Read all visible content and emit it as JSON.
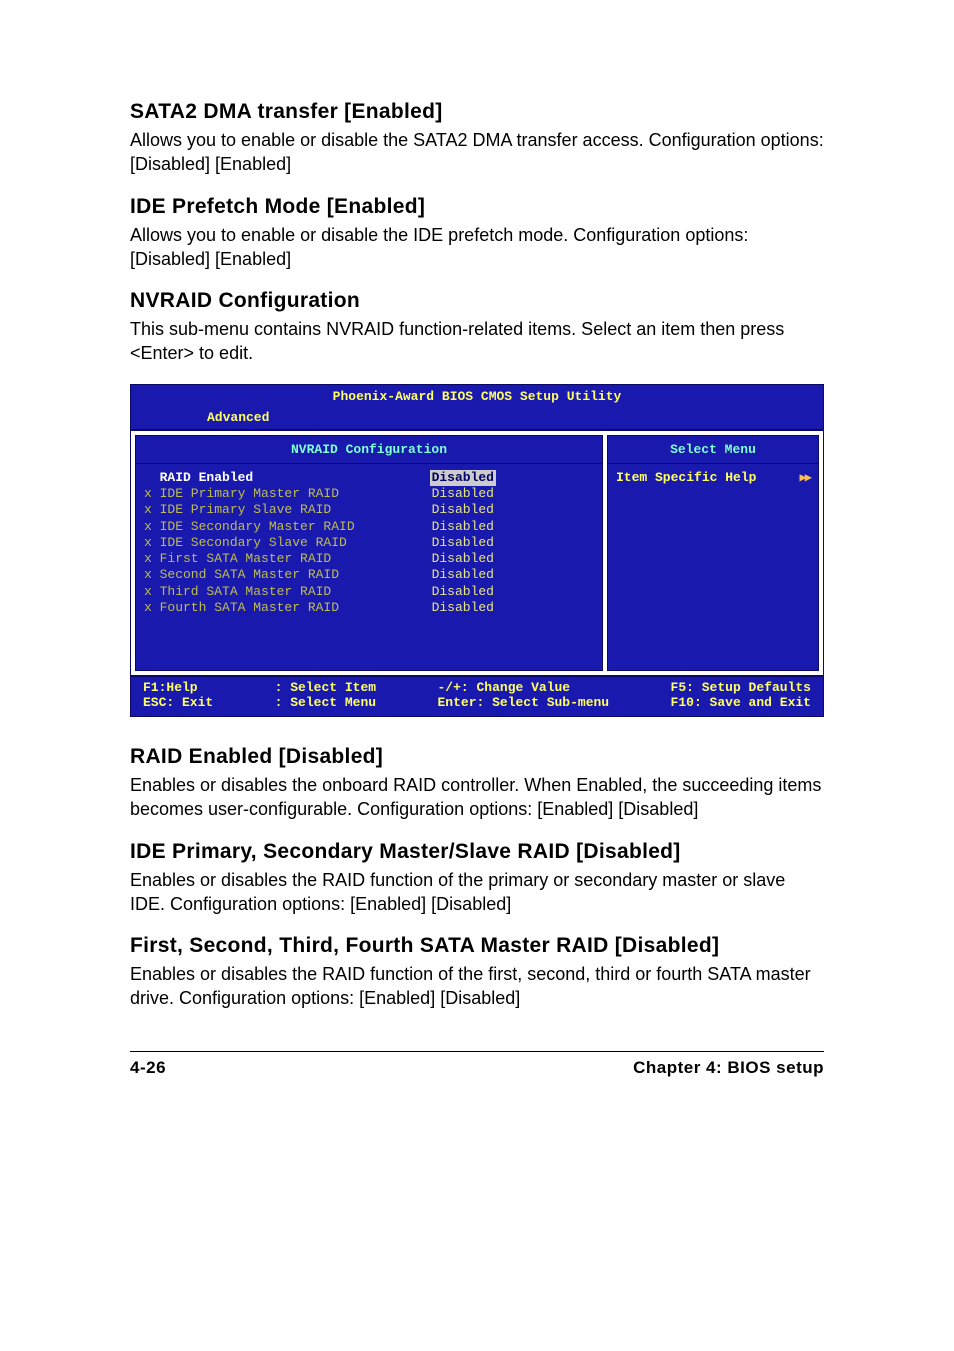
{
  "sections": {
    "sata2": {
      "heading": "SATA2 DMA transfer [Enabled]",
      "body": "Allows you to enable or disable the SATA2 DMA transfer access. Configuration options: [Disabled] [Enabled]"
    },
    "idePrefetch": {
      "heading": "IDE Prefetch Mode [Enabled]",
      "body": "Allows you to enable or disable the IDE prefetch mode. Configuration options: [Disabled] [Enabled]"
    },
    "nvraid": {
      "heading": "NVRAID Configuration",
      "body": "This sub-menu contains NVRAID function-related items. Select an item then press <Enter> to edit."
    },
    "raidEnabled": {
      "heading": "RAID Enabled [Disabled]",
      "body": "Enables or disables the onboard RAID controller. When Enabled, the succeeding items becomes user-configurable. Configuration options: [Enabled] [Disabled]"
    },
    "idePrimSec": {
      "heading": "IDE Primary, Secondary Master/Slave RAID [Disabled]",
      "body": "Enables or disables the RAID function of the primary or secondary master or slave IDE. Configuration options: [Enabled] [Disabled]"
    },
    "sataMaster": {
      "heading": "First, Second, Third, Fourth SATA Master RAID [Disabled]",
      "body": "Enables or disables the RAID function of the first, second, third or fourth SATA master drive. Configuration options: [Enabled] [Disabled]"
    }
  },
  "bios": {
    "title": "Phoenix-Award BIOS CMOS Setup Utility",
    "tab": "Advanced",
    "leftTitle": "NVRAID Configuration",
    "rightTitle": "Select Menu",
    "help": "Item Specific Help",
    "items": [
      {
        "label": "  RAID Enabled",
        "value": "Disabled",
        "selected": true,
        "dim": false
      },
      {
        "label": "x IDE Primary Master RAID",
        "value": "Disabled",
        "selected": false,
        "dim": true
      },
      {
        "label": "x IDE Primary Slave RAID",
        "value": "Disabled",
        "selected": false,
        "dim": true
      },
      {
        "label": "x IDE Secondary Master RAID",
        "value": "Disabled",
        "selected": false,
        "dim": true
      },
      {
        "label": "x IDE Secondary Slave RAID",
        "value": "Disabled",
        "selected": false,
        "dim": true
      },
      {
        "label": "x First SATA Master RAID",
        "value": "Disabled",
        "selected": false,
        "dim": true
      },
      {
        "label": "x Second SATA Master RAID",
        "value": "Disabled",
        "selected": false,
        "dim": true
      },
      {
        "label": "x Third SATA Master RAID",
        "value": "Disabled",
        "selected": false,
        "dim": true
      },
      {
        "label": "x Fourth SATA Master RAID",
        "value": "Disabled",
        "selected": false,
        "dim": true
      }
    ],
    "footer": {
      "c1a": "F1:Help",
      "c1b": "ESC: Exit",
      "c2a": ": Select Item",
      "c2b": ": Select Menu",
      "c3a": "-/+: Change Value",
      "c3b": "Enter: Select Sub-menu",
      "c4a": "F5: Setup Defaults",
      "c4b": "F10: Save and Exit"
    }
  },
  "pageFooter": {
    "left": "4-26",
    "right": "Chapter 4: BIOS setup"
  }
}
